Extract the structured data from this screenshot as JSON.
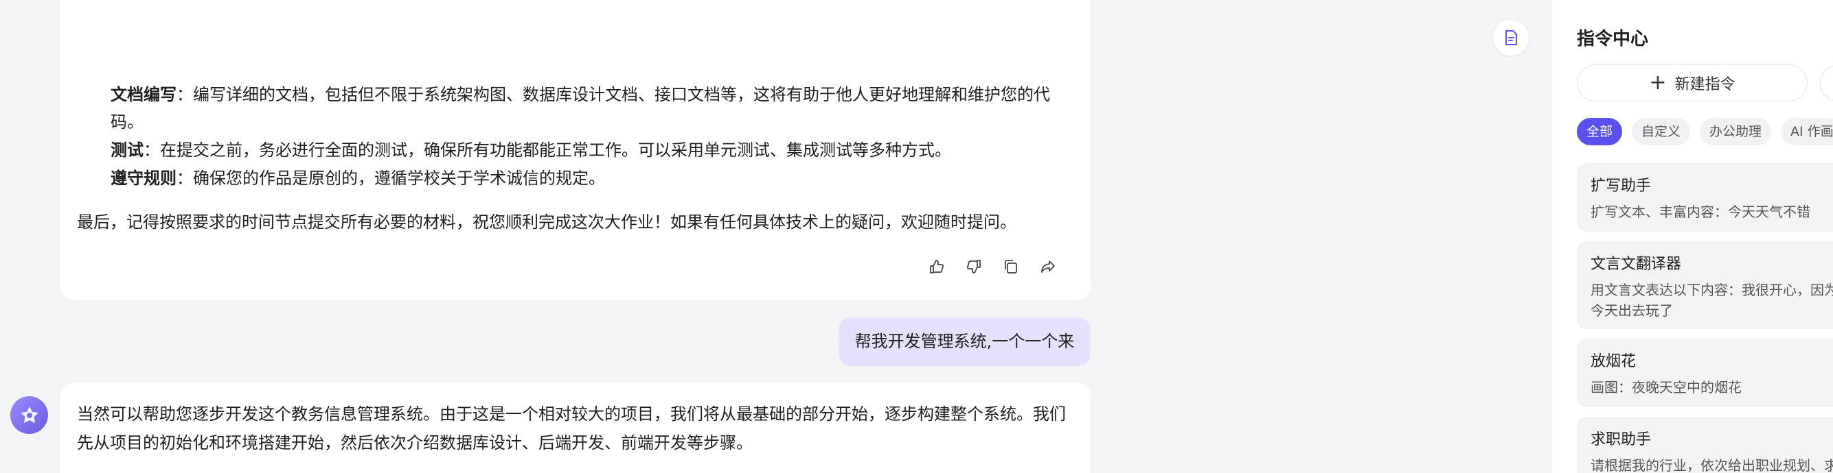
{
  "chat": {
    "ai_message_1": {
      "items": [
        {
          "label": "文档编写",
          "text": "：编写详细的文档，包括但不限于系统架构图、数据库设计文档、接口文档等，这将有助于他人更好地理解和维护您的代",
          "cont": "码。"
        },
        {
          "label": "测试",
          "text": "：在提交之前，务必进行全面的测试，确保所有功能都能正常工作。可以采用单元测试、集成测试等多种方式。"
        },
        {
          "label": "遵守规则",
          "text": "：确保您的作品是原创的，遵循学校关于学术诚信的规定。"
        }
      ],
      "closing": "最后，记得按照要求的时间节点提交所有必要的材料，祝您顺利完成这次大作业！如果有任何具体技术上的疑问，欢迎随时提问。",
      "actions": [
        "thumbs-up-icon",
        "thumbs-down-icon",
        "copy-icon",
        "share-icon"
      ]
    },
    "user_message": "帮我开发管理系统,一个一个来",
    "ai_message_2": {
      "line1": "当然可以帮助您逐步开发这个教务信息管理系统。由于这是一个相对较大的项目，我们将从最基础的部分开始，逐步构建整个系统。我们",
      "line2": "先从项目的初始化和环境搭建开始，然后依次介绍数据库设计、后端开发、前端开发等步骤。"
    }
  },
  "panel": {
    "title": "指令中心",
    "new_button": "新建指令",
    "tabs": [
      "全部",
      "自定义",
      "办公助理",
      "AI 作画"
    ],
    "active_tab": "全部",
    "commands": [
      {
        "title": "扩写助手",
        "desc": "扩写文本、丰富内容：今天天气不错"
      },
      {
        "title": "文言文翻译器",
        "desc": "用文言文表达以下内容：我很开心，因为",
        "desc2": "今天出去玩了"
      },
      {
        "title": "放烟花",
        "desc": "画图：夜晚天空中的烟花"
      },
      {
        "title": "求职助手",
        "desc": "请根据我的行业，依次给出职业规划、求"
      }
    ]
  },
  "colors": {
    "accent": "#5b4ff0",
    "user_bubble": "#e3e1fb",
    "background": "#f3f4f6"
  }
}
